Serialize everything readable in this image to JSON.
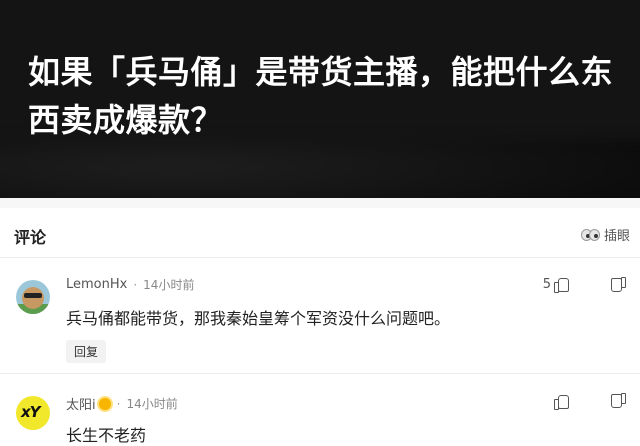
{
  "hero": {
    "title": "如果「兵马俑」是带货主播，能把什么东西卖成爆款？"
  },
  "comments_section": {
    "title": "评论",
    "danmaku_label": "插眼"
  },
  "comments": [
    {
      "username": "LemonHx",
      "separator": "·",
      "time": "14小时前",
      "likes": "5",
      "text": "兵马俑都能带货，那我秦始皇筹个军资没什么问题吧。",
      "reply_label": "回复",
      "avatar_icon": "dog-with-sunglasses-avatar"
    },
    {
      "username": "太阳i",
      "separator": "·",
      "time": "14小时前",
      "likes": "",
      "text": "长生不老药",
      "avatar_text": "xY",
      "avatar_icon": "yellow-xy-avatar"
    }
  ],
  "colors": {
    "hero_bg": "#141414",
    "text_primary": "#222222",
    "text_secondary": "#888888",
    "reply_bg": "#f2f2f2"
  }
}
